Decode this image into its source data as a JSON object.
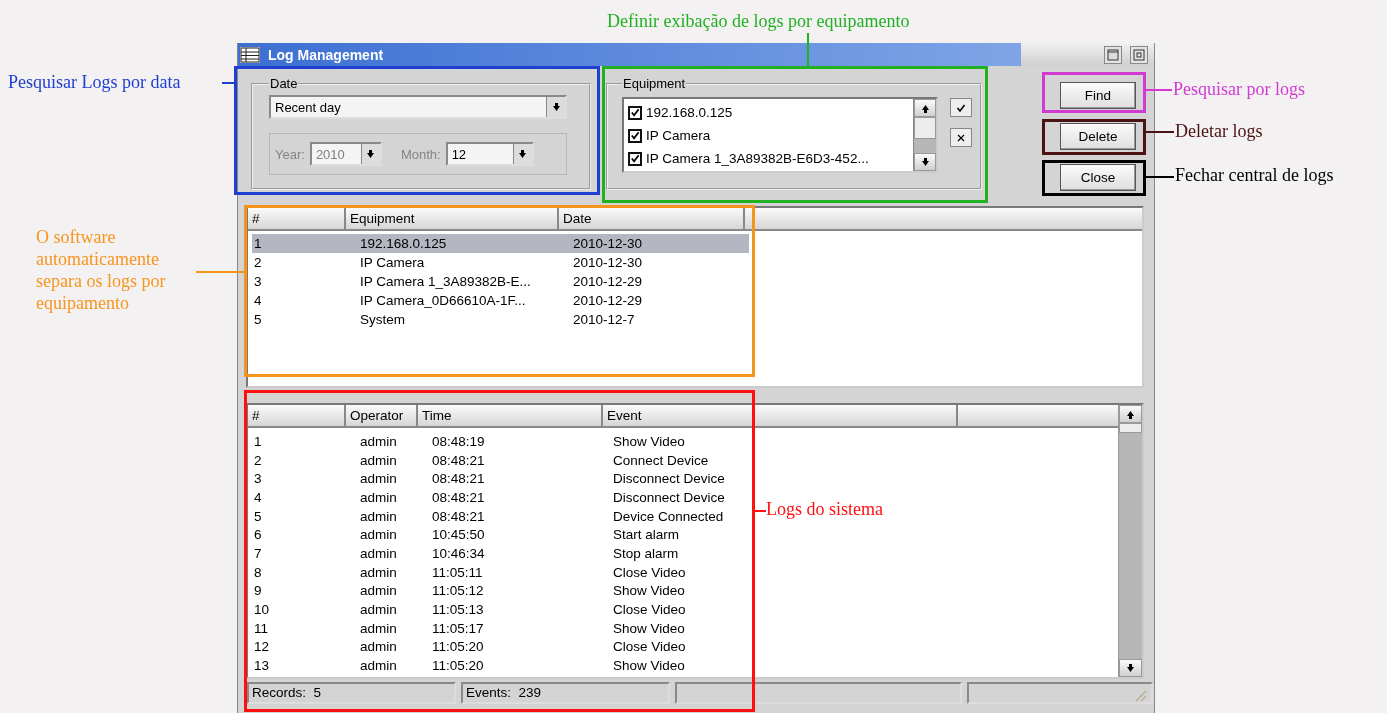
{
  "window": {
    "title": "Log Management"
  },
  "date_group": {
    "legend": "Date",
    "period": "Recent day",
    "custom_range": {
      "disabled": true,
      "fields": [
        {
          "label": "Year:",
          "value": "2010",
          "disabled": true
        },
        {
          "label": "Month:",
          "value": "12",
          "disabled": false
        }
      ]
    }
  },
  "equipment_group": {
    "legend": "Equipment",
    "items": [
      {
        "label": "192.168.0.125",
        "checked": true
      },
      {
        "label": "IP Camera",
        "checked": true
      },
      {
        "label": "IP Camera 1_3A89382B-E6D3-452...",
        "checked": true
      }
    ]
  },
  "buttons": [
    "Find",
    "Delete",
    "Close"
  ],
  "equipment_table": {
    "columns": [
      "#",
      "Equipment",
      "Date"
    ],
    "rows": [
      {
        "cells": [
          "1",
          "192.168.0.125",
          "2010-12-30"
        ],
        "selected": true
      },
      {
        "cells": [
          "2",
          "IP Camera",
          "2010-12-30"
        ],
        "selected": false
      },
      {
        "cells": [
          "3",
          "IP Camera 1_3A89382B-E...",
          "2010-12-29"
        ],
        "selected": false
      },
      {
        "cells": [
          "4",
          "IP Camera_0D66610A-1F...",
          "2010-12-29"
        ],
        "selected": false
      },
      {
        "cells": [
          "5",
          "System",
          "2010-12-7"
        ],
        "selected": false
      }
    ]
  },
  "log_table": {
    "columns": [
      "#",
      "Operator",
      "Time",
      "Event"
    ],
    "rows": [
      [
        "1",
        "admin",
        "08:48:19",
        "Show Video"
      ],
      [
        "2",
        "admin",
        "08:48:21",
        "Connect Device"
      ],
      [
        "3",
        "admin",
        "08:48:21",
        "Disconnect Device"
      ],
      [
        "4",
        "admin",
        "08:48:21",
        "Disconnect Device"
      ],
      [
        "5",
        "admin",
        "08:48:21",
        "Device Connected"
      ],
      [
        "6",
        "admin",
        "10:45:50",
        "Start alarm"
      ],
      [
        "7",
        "admin",
        "10:46:34",
        "Stop alarm"
      ],
      [
        "8",
        "admin",
        "11:05:11",
        "Close Video"
      ],
      [
        "9",
        "admin",
        "11:05:12",
        "Show Video"
      ],
      [
        "10",
        "admin",
        "11:05:13",
        "Close Video"
      ],
      [
        "11",
        "admin",
        "11:05:17",
        "Show Video"
      ],
      [
        "12",
        "admin",
        "11:05:20",
        "Close Video"
      ],
      [
        "13",
        "admin",
        "11:05:20",
        "Show Video"
      ]
    ]
  },
  "status_bar": [
    "Records:  5",
    "Events:  239"
  ],
  "annotations": [
    {
      "text": "Pesquisar Logs por data",
      "color": "#1f3fd0"
    },
    {
      "text": "Definir exibação de logs por equipamento",
      "color": "#21b021"
    },
    {
      "text": "Pesquisar por logs",
      "color": "#d23ad2"
    },
    {
      "text": "Deletar logs",
      "color": "#4a1212"
    },
    {
      "text": "Fechar central de logs",
      "color": "#000000"
    },
    {
      "text": "O software automaticamente separa os logs por equipamento",
      "color": "#f7941d"
    },
    {
      "text": "Logs do sistema",
      "color": "#ff1010"
    }
  ]
}
